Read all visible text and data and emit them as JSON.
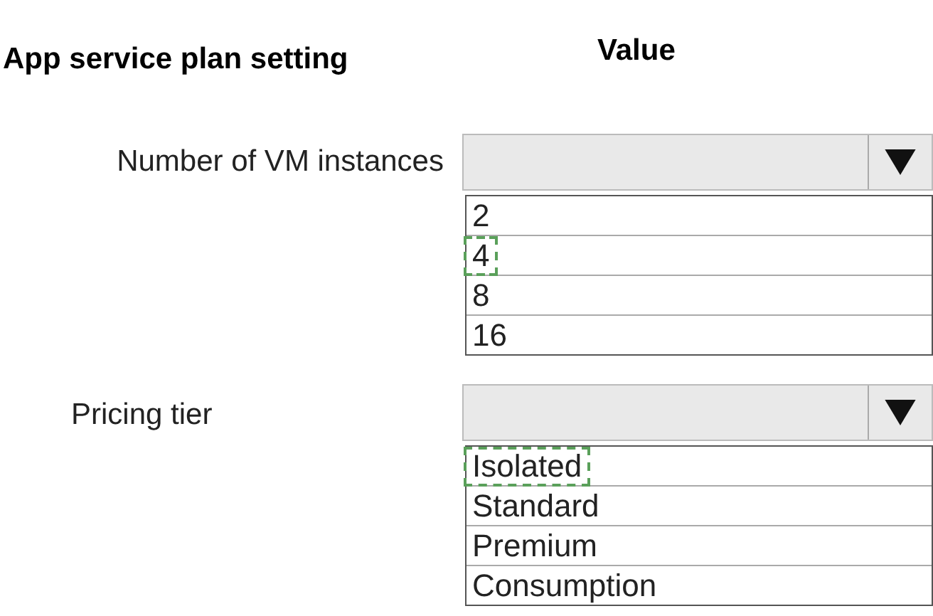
{
  "headers": {
    "setting": "App service plan setting",
    "value": "Value"
  },
  "settings": [
    {
      "label": "Number of VM instances",
      "options": [
        {
          "label": "2",
          "selected": false
        },
        {
          "label": "4",
          "selected": true
        },
        {
          "label": "8",
          "selected": false
        },
        {
          "label": "16",
          "selected": false
        }
      ]
    },
    {
      "label": "Pricing tier",
      "options": [
        {
          "label": "Isolated",
          "selected": true
        },
        {
          "label": "Standard",
          "selected": false
        },
        {
          "label": "Premium",
          "selected": false
        },
        {
          "label": "Consumption",
          "selected": false
        }
      ]
    }
  ]
}
